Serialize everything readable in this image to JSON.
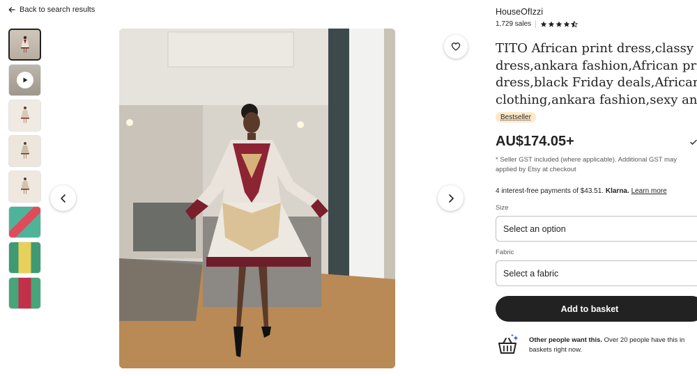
{
  "back_link": {
    "label": "Back to search results",
    "icon": "arrow-left-icon"
  },
  "gallery": {
    "thumbnails": [
      {
        "type": "image",
        "selected": true
      },
      {
        "type": "video",
        "icon": "play-icon"
      },
      {
        "type": "image"
      },
      {
        "type": "image"
      },
      {
        "type": "image"
      },
      {
        "type": "image"
      },
      {
        "type": "image"
      },
      {
        "type": "image"
      }
    ],
    "prev_icon": "chevron-left-icon",
    "next_icon": "chevron-right-icon",
    "favorite_icon": "heart-icon"
  },
  "listing": {
    "shop_name": "HouseOfIzzi",
    "sales": "1,729 sales",
    "rating_stars": 4.5,
    "title_lines": [
      "TITO African print dress,classy",
      "dress,ankara fashion,African print",
      "dress,black Friday deals,African",
      "clothing,ankara fashion,sexy ankara"
    ],
    "badge": "Bestseller",
    "price": "AU$174.05+",
    "tax_lines": [
      "* Seller GST included (where applicable). Additional GST may",
      "applied by Etsy at checkout"
    ],
    "klarna": {
      "prefix": "4 interest-free payments of $43.51.",
      "brand": "Klarna.",
      "link": "Learn more"
    },
    "size": {
      "label": "Size",
      "value": "Select an option"
    },
    "fabric": {
      "label": "Fabric",
      "value": "Select a fabric"
    },
    "add_to_basket": "Add to basket",
    "demand": {
      "bold": "Other people want this.",
      "line1_rest": " Over 20 people have this in",
      "line2": "baskets right now.",
      "icon": "basket-sparkle-icon"
    }
  },
  "colors": {
    "primary_button": "#222222",
    "badge_bg": "#fde9c8",
    "star": "#222222"
  }
}
